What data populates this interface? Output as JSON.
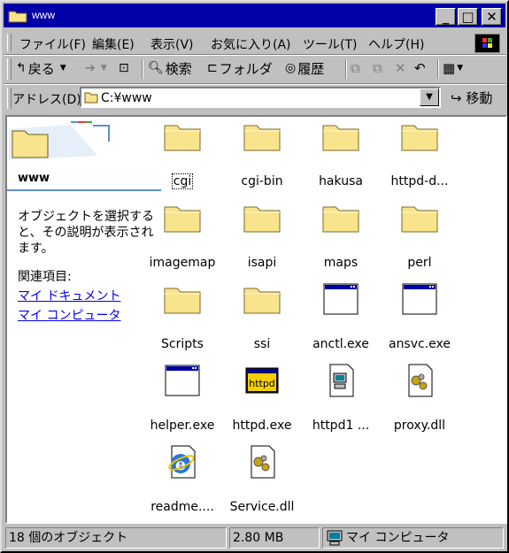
{
  "window": {
    "title": "www",
    "minimize_label": "_",
    "maximize_label": "□",
    "close_label": "✕"
  },
  "menubar": {
    "items": [
      "ファイル(F)",
      "編集(E)",
      "表示(V)",
      "お気に入り(A)",
      "ツール(T)",
      "ヘルプ(H)"
    ]
  },
  "toolbar": {
    "back_label": "戻る",
    "search_label": "検索",
    "folders_label": "フォルダ",
    "history_label": "履歴"
  },
  "address": {
    "label": "アドレス(D)",
    "value": "C:¥www",
    "go_label": "移動"
  },
  "left_pane": {
    "folder_title": "www",
    "description": "オブジェクトを選択すると、その説明が表示されます。",
    "related_label": "関連項目:",
    "links": [
      "マイ ドキュメント",
      "マイ コンピュータ"
    ]
  },
  "files": [
    {
      "name": "cgi",
      "type": "folder",
      "focused": true
    },
    {
      "name": "cgi-bin",
      "type": "folder"
    },
    {
      "name": "hakusa",
      "type": "folder"
    },
    {
      "name": "httpd-d...",
      "type": "folder"
    },
    {
      "name": "imagemap",
      "type": "folder"
    },
    {
      "name": "isapi",
      "type": "folder"
    },
    {
      "name": "maps",
      "type": "folder"
    },
    {
      "name": "perl",
      "type": "folder"
    },
    {
      "name": "Scripts",
      "type": "folder"
    },
    {
      "name": "ssi",
      "type": "folder"
    },
    {
      "name": "anctl.exe",
      "type": "exe"
    },
    {
      "name": "ansvc.exe",
      "type": "exe"
    },
    {
      "name": "helper.exe",
      "type": "exe"
    },
    {
      "name": "httpd.exe",
      "type": "httpd"
    },
    {
      "name": "httpd1 ...",
      "type": "cpl"
    },
    {
      "name": "proxy.dll",
      "type": "dll"
    },
    {
      "name": "readme....",
      "type": "ie"
    },
    {
      "name": "Service.dll",
      "type": "dll"
    }
  ],
  "httpd_icon_text": "httpd",
  "status": {
    "count": "18 個のオブジェクト",
    "size": "2.80 MB",
    "location": "マイ コンピュータ"
  },
  "colors": {
    "title_bar": "#0000a8",
    "face": "#c0c0c0",
    "folder": "#f9e48e",
    "link": "#0000ee"
  }
}
